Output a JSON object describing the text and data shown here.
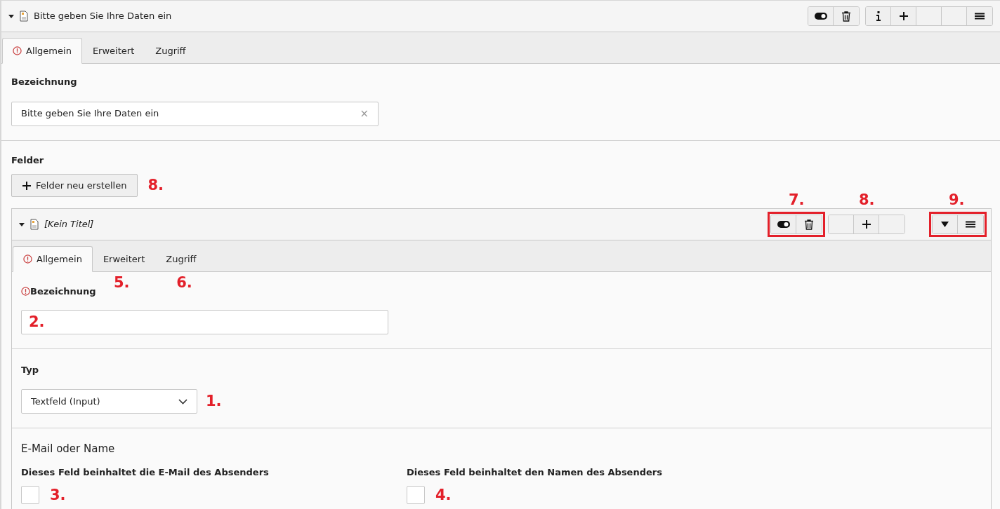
{
  "record": {
    "title": "Bitte geben Sie Ihre Daten ein",
    "expanded": true
  },
  "tabs": [
    {
      "label": "Allgemein",
      "selected": true,
      "error": true
    },
    {
      "label": "Erweitert",
      "selected": false,
      "error": false
    },
    {
      "label": "Zugriff",
      "selected": false,
      "error": false
    }
  ],
  "bezeichnung": {
    "label": "Bezeichnung",
    "value": "Bitte geben Sie Ihre Daten ein",
    "clear": "×"
  },
  "felder": {
    "label": "Felder",
    "button": "Felder neu erstellen",
    "annotation": "8."
  },
  "field_record": {
    "title": "[Kein Titel]",
    "expanded": true,
    "toolbar_annotations": {
      "visibility": "7.",
      "add": "8.",
      "move": "9."
    },
    "tabs": [
      {
        "label": "Allgemein",
        "selected": true,
        "error": true
      },
      {
        "label": "Erweitert",
        "selected": false,
        "error": false,
        "annotation": "5."
      },
      {
        "label": "Zugriff",
        "selected": false,
        "error": false,
        "annotation": "6."
      }
    ],
    "bezeichnung": {
      "label": "Bezeichnung",
      "required": true,
      "annotation": "2."
    },
    "typ": {
      "label": "Typ",
      "value": "Textfeld (Input)",
      "annotation": "1."
    },
    "section": "E-Mail oder Name",
    "checkboxes": [
      {
        "label": "Dieses Feld beinhaltet die E-Mail des Absenders",
        "checked": false,
        "annotation": "3."
      },
      {
        "label": "Dieses Feld beinhaltet den Namen des Absenders",
        "checked": false,
        "annotation": "4."
      }
    ]
  }
}
